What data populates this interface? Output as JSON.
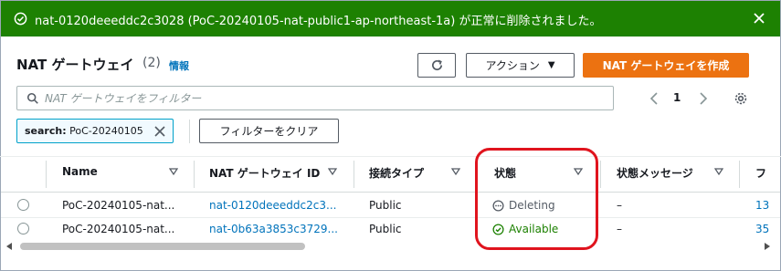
{
  "flash": {
    "message": "nat-0120deeeddc2c3028 (PoC-20240105-nat-public1-ap-northeast-1a) が正常に削除されました。",
    "icon": "check-circle-icon",
    "close_icon": "close-icon",
    "color": "#1d8102"
  },
  "header": {
    "title": "NAT ゲートウェイ",
    "count": "(2)",
    "info": "情報"
  },
  "toolbar": {
    "refresh_icon": "refresh-icon",
    "actions_label": "アクション",
    "create_label": "NAT ゲートウェイを作成",
    "accent_color": "#ec7211"
  },
  "search": {
    "placeholder": "NAT ゲートウェイをフィルター",
    "value": ""
  },
  "pagination": {
    "page": "1"
  },
  "filter": {
    "token_key": "search:",
    "token_value": "PoC-20240105",
    "clear_label": "フィルターをクリア"
  },
  "table": {
    "columns": [
      "Name",
      "NAT ゲートウェイ ID",
      "接続タイプ",
      "状態",
      "状態メッセージ",
      "フ"
    ],
    "rows": [
      {
        "name": "PoC-20240105-nat...",
        "id": "nat-0120deeeddc2c3...",
        "type": "Public",
        "state": "Deleting",
        "message": "–",
        "extra": "13"
      },
      {
        "name": "PoC-20240105-nat...",
        "id": "nat-0b63a3853c3729...",
        "type": "Public",
        "state": "Available",
        "message": "–",
        "extra": "35"
      }
    ]
  },
  "highlight_color": "#e0141e"
}
